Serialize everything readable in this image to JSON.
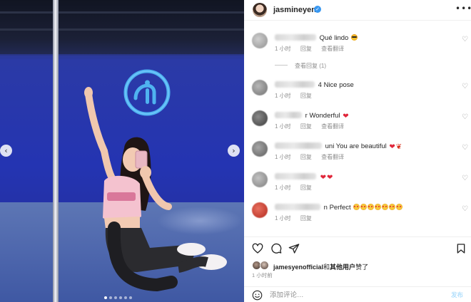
{
  "post": {
    "username": "jasmineyen",
    "verified_icon": "verified-badge-icon",
    "more_icon": "more-horizontal-icon",
    "carousel": {
      "slide_count": 6,
      "active_slide": 1,
      "prev_icon": "chevron-left-icon",
      "next_icon": "chevron-right-icon"
    }
  },
  "comments": [
    {
      "text": "Qué lindo",
      "emoji": [
        "smiling-face-with-sunglasses"
      ],
      "time": "1 小时",
      "reply": "回复",
      "translate": "查看翻译",
      "view_replies": "查看回复 (1)"
    },
    {
      "text": "4 Nice pose",
      "emoji": [],
      "time": "1 小时",
      "reply": "回复"
    },
    {
      "text": "r Wonderful",
      "emoji": [
        "red-heart"
      ],
      "time": "1 小时",
      "reply": "回复",
      "translate": "查看翻译"
    },
    {
      "text": "uni You are beautiful",
      "emoji": [
        "red-heart",
        "rose-heart"
      ],
      "time": "1 小时",
      "reply": "回复",
      "translate": "查看翻译"
    },
    {
      "text": "",
      "emoji": [
        "red-heart",
        "red-heart"
      ],
      "time": "1 小时",
      "reply": "回复"
    },
    {
      "text": "n Perfect",
      "emoji": [
        "star-struck",
        "star-struck",
        "star-struck",
        "star-struck",
        "star-struck",
        "star-struck",
        "star-struck"
      ],
      "time": "1 小时",
      "reply": "回复"
    }
  ],
  "liked_by": {
    "account": "jamesyenofficial",
    "joiner": "和",
    "others": "其他用户",
    "suffix": "赞了"
  },
  "post_time": "1 小时前",
  "add_comment": {
    "placeholder": "添加评论…",
    "post_label": "发布"
  },
  "colors": {
    "accent": "#0095f6",
    "post_disabled": "#b2dffc",
    "heart": "#e0263a",
    "wall": "#2434b2"
  }
}
